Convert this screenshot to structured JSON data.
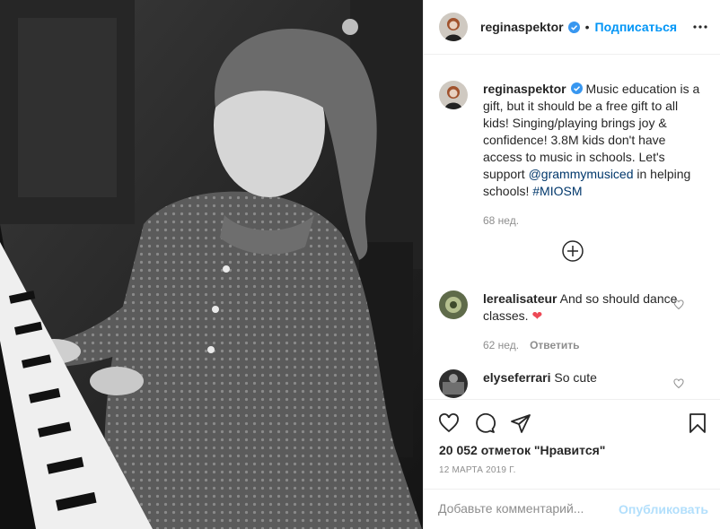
{
  "post": {
    "username": "reginaspektor",
    "follow_label": "Подписаться",
    "dot": "•",
    "caption_text": "Music education is a gift, but it should be a free gift to all kids! Singing/playing brings joy & confidence! 3.8M kids don't have access to music in schools. Let's support ",
    "caption_mention": "@grammymusiced",
    "caption_middle": " in helping schools! ",
    "caption_hashtag": "#MIOSM",
    "caption_age": "68 нед."
  },
  "comments": [
    {
      "username": "lerealisateur",
      "text": "And so should dance classes. ",
      "emoji": "❤",
      "age": "62 нед.",
      "reply_label": "Ответить"
    },
    {
      "username": "elyseferrari",
      "text": "So cute"
    }
  ],
  "actions": {
    "likes": "20 052 отметок \"Нравится\"",
    "date": "12 МАРТА 2019 Г."
  },
  "add_comment": {
    "placeholder": "Добавьте комментарий...",
    "publish_label": "Опубликовать"
  },
  "colors": {
    "accent": "#0095f6",
    "heart": "#ed4956",
    "publish_disabled": "#b2dffc"
  }
}
